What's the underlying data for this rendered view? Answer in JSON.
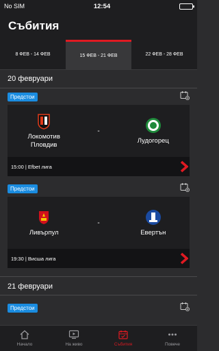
{
  "status_bar": {
    "carrier": "No SIM",
    "time": "12:54"
  },
  "header": {
    "title": "Събития"
  },
  "weeks": [
    {
      "label": "8 ФЕВ - 14 ФЕВ"
    },
    {
      "label": "15 ФЕВ - 21 ФЕВ"
    },
    {
      "label": "22 ФЕВ - 28 ФЕВ"
    }
  ],
  "days": [
    {
      "title": "20 февруари",
      "events": [
        {
          "badge": "Предстои",
          "home": "Локомотив\nПловдив",
          "away": "Лудогорец",
          "vs": "-",
          "info": "15:00 | Efbet лига",
          "home_color": "#e03a1a",
          "away_color": "#1f8a3b"
        },
        {
          "badge": "Предстои",
          "home": "Ливърпул",
          "away": "Евертън",
          "vs": "-",
          "info": "19:30 | Висша лига",
          "home_color": "#d0101c",
          "away_color": "#1a4aa0"
        }
      ]
    },
    {
      "title": "21 февруари",
      "events": [
        {
          "badge": "Предстои"
        }
      ]
    }
  ],
  "tabbar": [
    {
      "label": "Начало",
      "icon": "home-icon"
    },
    {
      "label": "На живо",
      "icon": "tv-icon"
    },
    {
      "label": "Събития",
      "icon": "calendar-icon"
    },
    {
      "label": "Повече",
      "icon": "more-icon"
    }
  ],
  "colors": {
    "accent": "#e01a22",
    "badge": "#1a8ce0"
  }
}
